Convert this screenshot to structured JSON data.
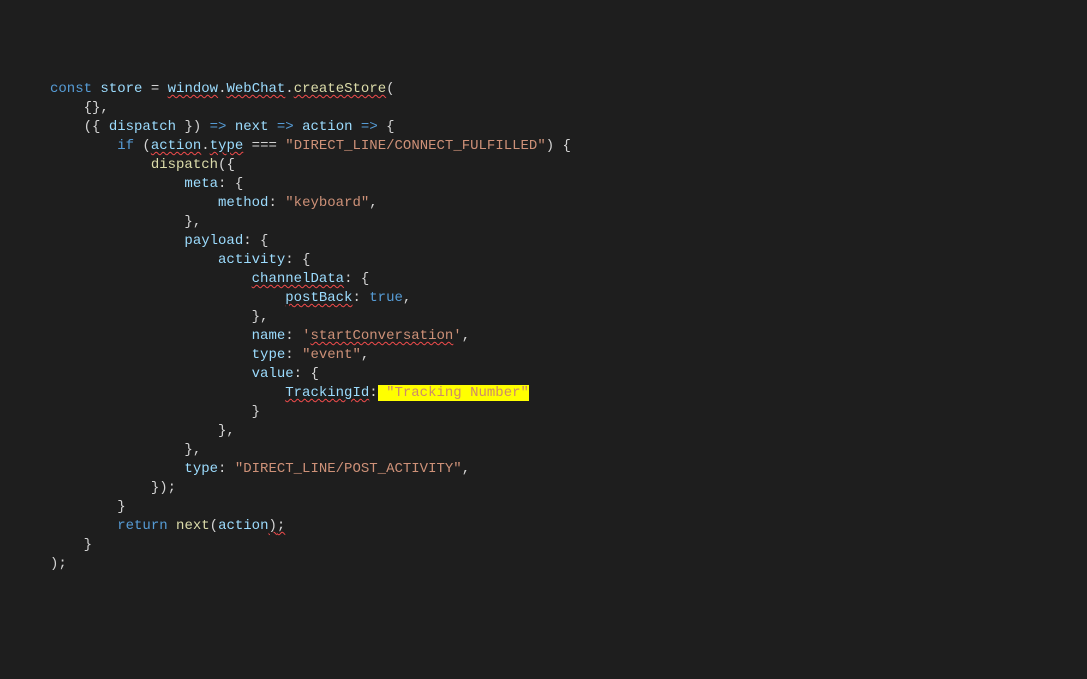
{
  "code": {
    "kw_const": "const",
    "var_store": "store",
    "op_assign": " = ",
    "var_window": "window",
    "dot1": ".",
    "prop_webchat": "WebChat",
    "dot2": ".",
    "fn_createStore": "createStore",
    "paren_open1": "(",
    "brace_pair_empty": "{},",
    "paren_open2": "({ ",
    "var_dispatch": "dispatch",
    "close_destruct": " }) ",
    "arrow1": "=>",
    "var_next": " next ",
    "arrow2": "=>",
    "var_action": " action ",
    "arrow3": "=>",
    "brace_open_body": " {",
    "kw_if": "if",
    "paren_if_open": " (",
    "var_action2": "action",
    "dot3": ".",
    "prop_type_chain": "type",
    "op_eq": " === ",
    "str_connect": "\"DIRECT_LINE/CONNECT_FULFILLED\"",
    "paren_if_close": ") {",
    "fn_dispatch_call": "dispatch",
    "paren_open3": "({",
    "prop_meta": "meta",
    "colon_brace1": ": {",
    "prop_method": "method",
    "colon1": ": ",
    "str_keyboard": "\"keyboard\"",
    "comma1": ",",
    "brace_close1": "},",
    "prop_payload": "payload",
    "colon_brace2": ": {",
    "prop_activity": "activity",
    "colon_brace3": ": {",
    "prop_channelData": "channelData",
    "colon_brace4": ": {",
    "prop_postBack": "postBack",
    "colon2": ": ",
    "lit_true": "true",
    "comma2": ",",
    "brace_close2": "},",
    "prop_name": "name",
    "colon3": ": ",
    "str_startconv_open": "'",
    "str_startconv": "startConversation",
    "str_startconv_close": "'",
    "comma3": ",",
    "prop_type2": "type",
    "colon4": ": ",
    "str_event": "\"event\"",
    "comma4": ",",
    "prop_value": "value",
    "colon_brace5": ": {",
    "prop_trackingId": "TrackingId",
    "colon5": ":",
    "hl_space": " ",
    "str_tracking": "\"Tracking Number\"",
    "brace_close3": "}",
    "brace_close4": "},",
    "brace_close5": "},",
    "prop_type3": "type",
    "colon6": ": ",
    "str_post_activity": "\"DIRECT_LINE/POST_ACTIVITY\"",
    "comma5": ",",
    "close_dispatch": "});",
    "brace_close_if": "}",
    "kw_return": "return",
    "sp_return": " ",
    "fn_next": "next",
    "paren_open4": "(",
    "var_action3": "action",
    "paren_close4": ")",
    "semi_end": ";",
    "brace_close_arrow": "}",
    "close_store": ");"
  }
}
